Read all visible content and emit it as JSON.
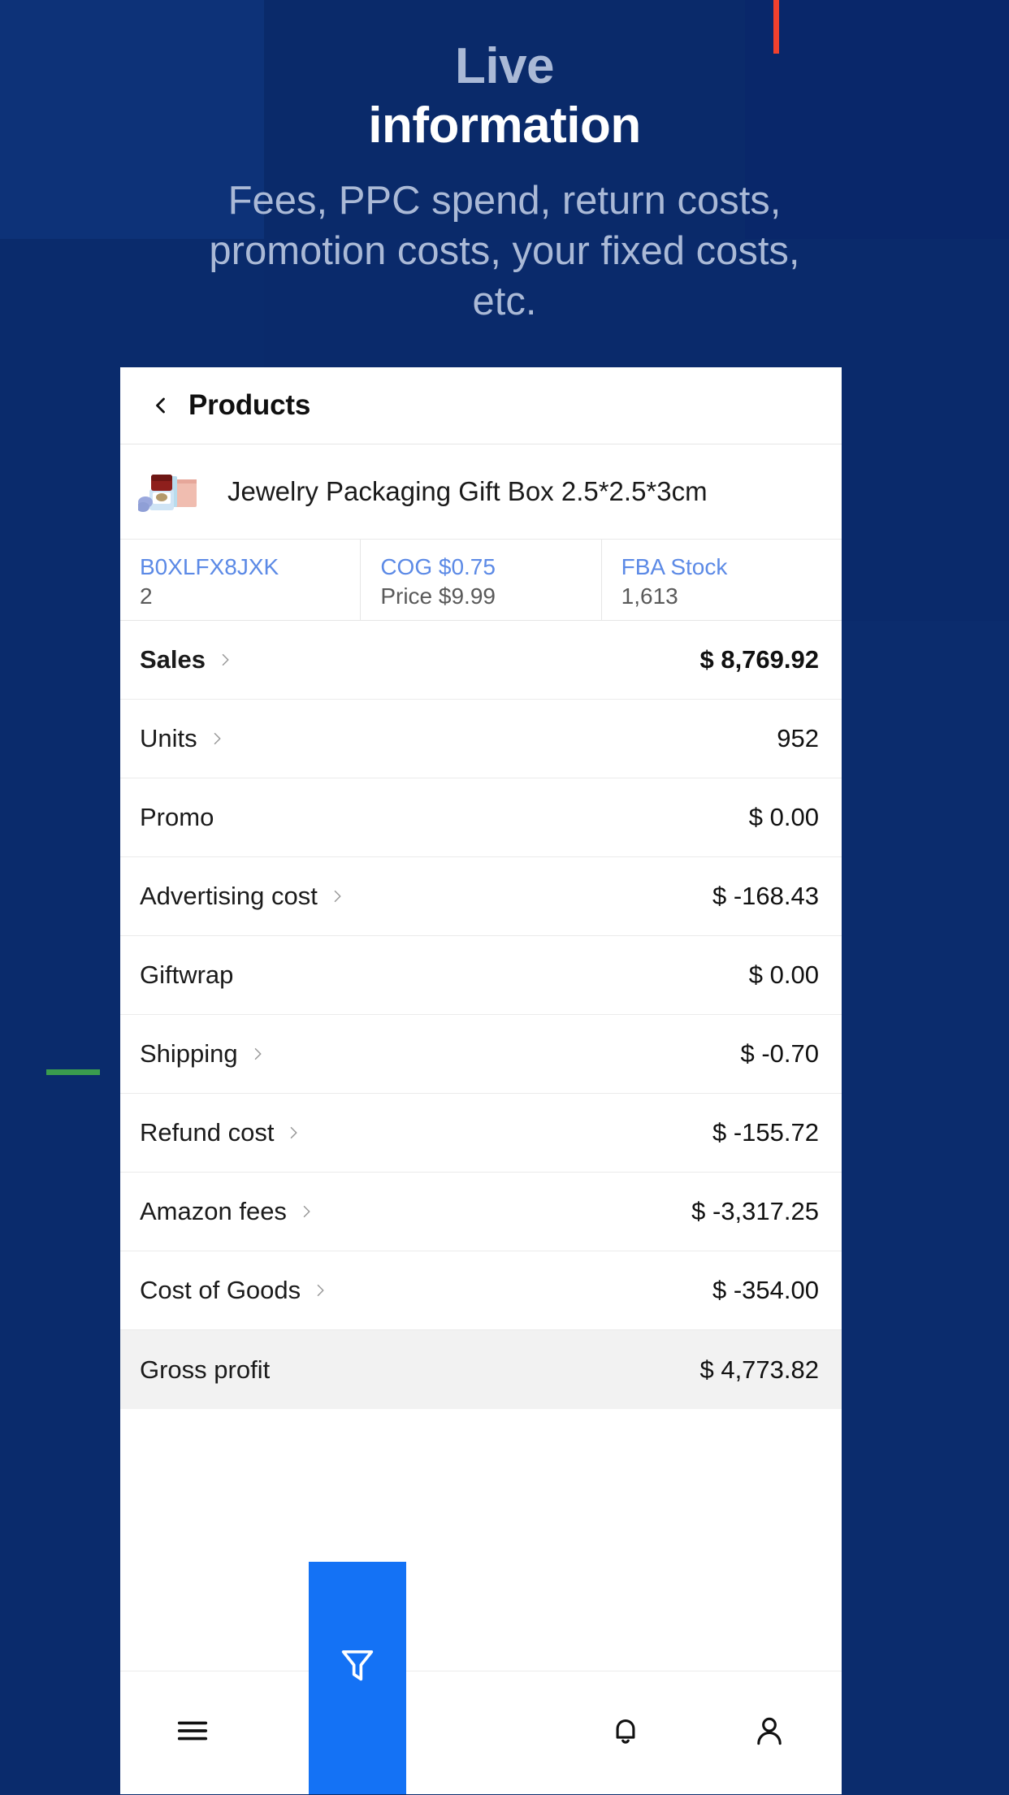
{
  "hero": {
    "title_line1": "Live",
    "title_line2": "information",
    "subtitle": "Fees, PPC spend, return costs, promotion costs, your fixed costs, etc."
  },
  "colors": {
    "background": "#082561",
    "red_accent": "#f0412e",
    "green_accent": "#3a9c4e",
    "nav_active": "#1472f5",
    "link_blue": "#5c8ae6"
  },
  "card": {
    "header": {
      "back_icon": "chevron-left-icon",
      "title": "Products"
    },
    "product": {
      "thumbnail_icon": "product-thumbnail",
      "name": "Jewelry Packaging Gift Box 2.5*2.5*3cm"
    },
    "info": [
      {
        "top": "B0XLFX8JXK",
        "bottom": "2"
      },
      {
        "top": "COG $0.75",
        "bottom": "Price $9.99"
      },
      {
        "top": "FBA Stock",
        "bottom": "1,613"
      }
    ],
    "metrics": [
      {
        "label": "Sales",
        "value": "$ 8,769.92",
        "chevron": true,
        "bold": true,
        "highlight": false
      },
      {
        "label": "Units",
        "value": "952",
        "chevron": true,
        "bold": false,
        "highlight": false
      },
      {
        "label": "Promo",
        "value": "$ 0.00",
        "chevron": false,
        "bold": false,
        "highlight": false
      },
      {
        "label": "Advertising cost",
        "value": "$ -168.43",
        "chevron": true,
        "bold": false,
        "highlight": false
      },
      {
        "label": "Giftwrap",
        "value": "$ 0.00",
        "chevron": false,
        "bold": false,
        "highlight": false
      },
      {
        "label": "Shipping",
        "value": "$ -0.70",
        "chevron": true,
        "bold": false,
        "highlight": false
      },
      {
        "label": "Refund cost",
        "value": "$ -155.72",
        "chevron": true,
        "bold": false,
        "highlight": false
      },
      {
        "label": "Amazon fees",
        "value": "$ -3,317.25",
        "chevron": true,
        "bold": false,
        "highlight": false
      },
      {
        "label": "Cost of Goods",
        "value": "$ -354.00",
        "chevron": true,
        "bold": false,
        "highlight": false
      },
      {
        "label": "Gross profit",
        "value": "$ 4,773.82",
        "chevron": false,
        "bold": false,
        "highlight": true
      }
    ]
  },
  "bottom_nav": [
    {
      "icon": "menu-icon",
      "active": false
    },
    {
      "icon": "dashboard-icon",
      "active": false
    },
    {
      "icon": "filter-icon",
      "active": true
    },
    {
      "icon": "bell-icon",
      "active": false
    },
    {
      "icon": "user-icon",
      "active": false
    }
  ]
}
